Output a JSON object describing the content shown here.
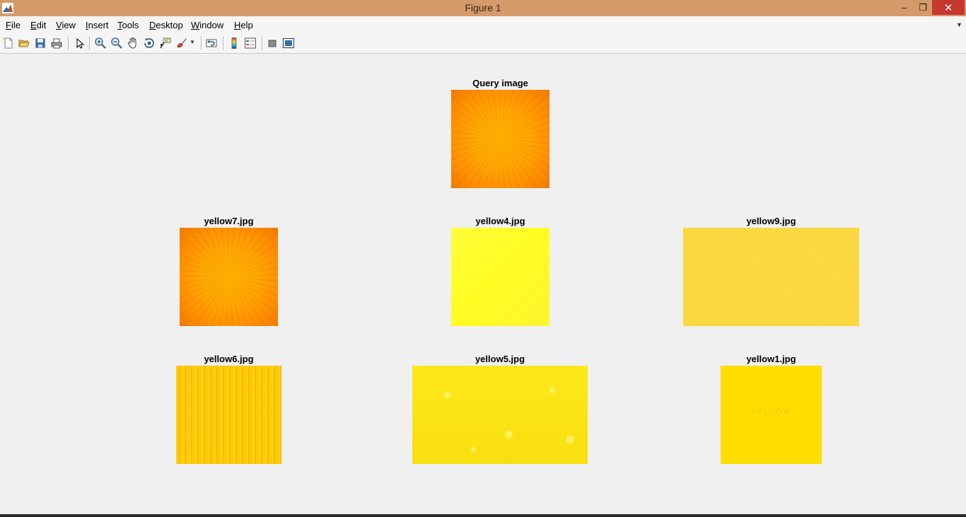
{
  "window": {
    "title": "Figure 1",
    "controls": {
      "minimize": "–",
      "restore": "❐",
      "close": "✕"
    }
  },
  "menu": {
    "items": [
      {
        "label": "File",
        "accel": "F",
        "rest": "ile"
      },
      {
        "label": "Edit",
        "accel": "E",
        "rest": "dit"
      },
      {
        "label": "View",
        "accel": "V",
        "rest": "iew"
      },
      {
        "label": "Insert",
        "accel": "I",
        "rest": "nsert"
      },
      {
        "label": "Tools",
        "accel": "T",
        "rest": "ools"
      },
      {
        "label": "Desktop",
        "accel": "D",
        "rest": "esktop"
      },
      {
        "label": "Window",
        "accel": "W",
        "rest": "indow"
      },
      {
        "label": "Help",
        "accel": "H",
        "rest": "elp"
      }
    ],
    "overflow_arrow": "▼"
  },
  "toolbar": {
    "icons": [
      "new-figure-icon",
      "open-file-icon",
      "save-figure-icon",
      "print-figure-icon",
      "edit-plot-icon",
      "zoom-in-icon",
      "zoom-out-icon",
      "pan-icon",
      "rotate-3d-icon",
      "data-cursor-icon",
      "brush-icon",
      "link-plot-icon",
      "insert-colorbar-icon",
      "insert-legend-icon",
      "hide-plot-tools-icon",
      "show-plot-tools-icon"
    ]
  },
  "figure": {
    "query": {
      "title": "Query image"
    },
    "results": [
      {
        "title": "yellow7.jpg"
      },
      {
        "title": "yellow4.jpg"
      },
      {
        "title": "yellow9.jpg"
      },
      {
        "title": "yellow6.jpg"
      },
      {
        "title": "yellow5.jpg"
      },
      {
        "title": "yellow1.jpg"
      }
    ],
    "yellow1_watermark": "YELLOW"
  },
  "colors": {
    "titlebar": "#d49a6a",
    "close_button": "#c7372f",
    "figure_background": "#f0f0f0"
  }
}
